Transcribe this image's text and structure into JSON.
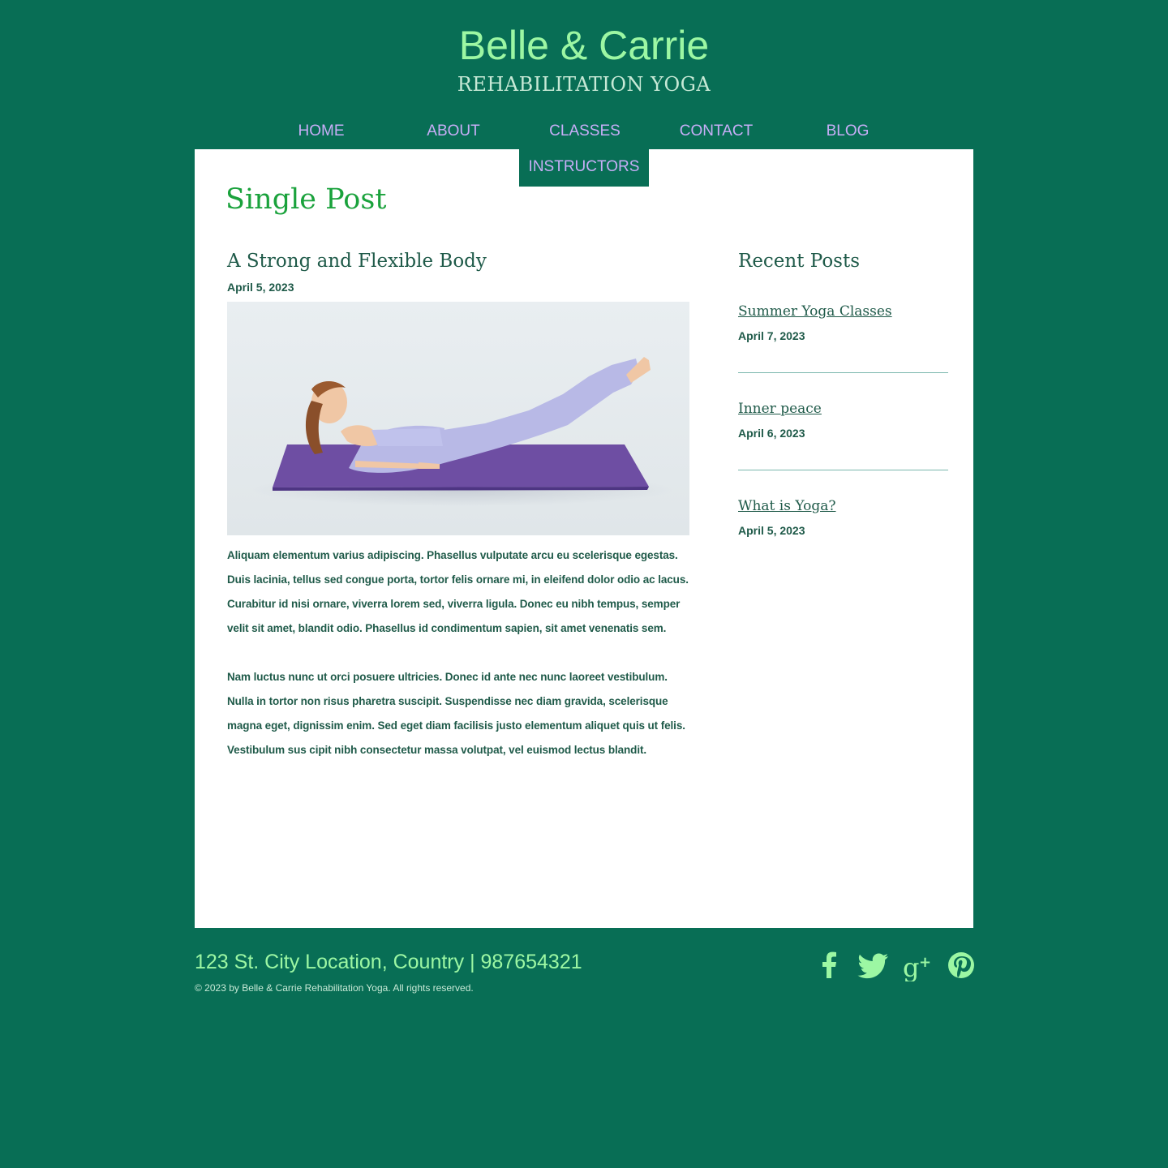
{
  "site": {
    "title": "Belle & Carrie",
    "subtitle": "REHABILITATION YOGA"
  },
  "nav": {
    "items": [
      "HOME",
      "ABOUT",
      "CLASSES",
      "CONTACT",
      "BLOG"
    ],
    "sub_item": "INSTRUCTORS"
  },
  "page": {
    "title": "Single Post"
  },
  "post": {
    "title": "A Strong and Flexible Body",
    "date": "April 5, 2023",
    "image_alt": "woman doing a boat pose on a purple yoga mat",
    "paragraphs": [
      "Aliquam elementum varius adipiscing. Phasellus vulputate arcu eu scelerisque egestas. Duis lacinia, tellus sed congue porta, tortor felis ornare mi, in eleifend dolor odio ac lacus. Curabitur id nisi ornare, viverra lorem sed, viverra ligula.  Donec eu nibh tempus, semper velit sit amet, blandit odio. Phasellus id condimentum sapien, sit amet venenatis sem.",
      "Nam luctus nunc ut orci posuere ultricies. Donec id ante nec nunc laoreet vestibulum. Nulla in tortor non risus pharetra suscipit. Suspendisse nec diam gravida, scelerisque magna eget, dignissim enim. Sed eget diam facilisis justo elementum aliquet quis ut felis. Vestibulum sus cipit nibh consectetur massa volutpat, vel euismod lectus blandit."
    ]
  },
  "sidebar": {
    "heading": "Recent Posts",
    "posts": [
      {
        "title": "Summer Yoga Classes",
        "date": "April 7, 2023"
      },
      {
        "title": "Inner peace",
        "date": "April 6, 2023"
      },
      {
        "title": "What is Yoga?",
        "date": "April 5, 2023"
      }
    ]
  },
  "footer": {
    "address": "123 St. City Location, Country | 987654321",
    "copyright": "© 2023 by Belle & Carrie Rehabilitation Yoga.  All rights reserved.",
    "social": [
      "facebook-icon",
      "twitter-icon",
      "google-plus-icon",
      "pinterest-icon"
    ]
  },
  "colors": {
    "background": "#086e55",
    "title_green": "#9cf7a3",
    "nav_purple": "#c7aef7",
    "heading_green": "#1aa23c",
    "text_dark": "#1f5a49"
  }
}
